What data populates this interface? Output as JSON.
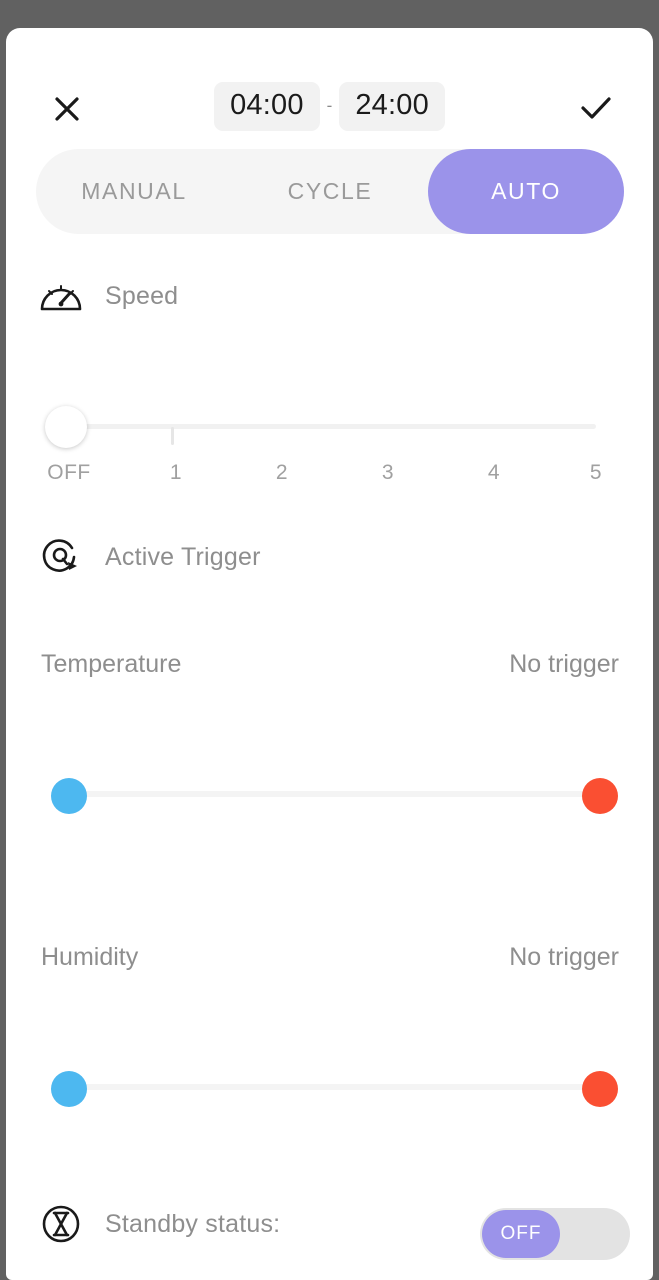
{
  "header": {
    "close_icon": "close-icon",
    "confirm_icon": "check-icon",
    "start_time": "04:00",
    "separator": "-",
    "end_time": "24:00"
  },
  "tabs": [
    {
      "label": "MANUAL",
      "active": false
    },
    {
      "label": "CYCLE",
      "active": false
    },
    {
      "label": "AUTO",
      "active": true
    }
  ],
  "speed": {
    "icon": "speedometer-icon",
    "label": "Speed",
    "value": "OFF",
    "ticks": [
      "OFF",
      "1",
      "2",
      "3",
      "4",
      "5"
    ]
  },
  "active_trigger": {
    "icon": "trigger-refresh-icon",
    "label": "Active Trigger",
    "rows": [
      {
        "label": "Temperature",
        "value": "No trigger"
      },
      {
        "label": "Humidity",
        "value": "No trigger"
      }
    ]
  },
  "standby": {
    "icon": "hourglass-icon",
    "label": "Standby status:",
    "toggle_value": "OFF"
  },
  "colors": {
    "accent_purple": "#9b93ea",
    "handle_min_blue": "#4db8f0",
    "handle_max_red": "#fa4f32",
    "backdrop": "#616161",
    "muted_text": "#8e8e8e"
  }
}
